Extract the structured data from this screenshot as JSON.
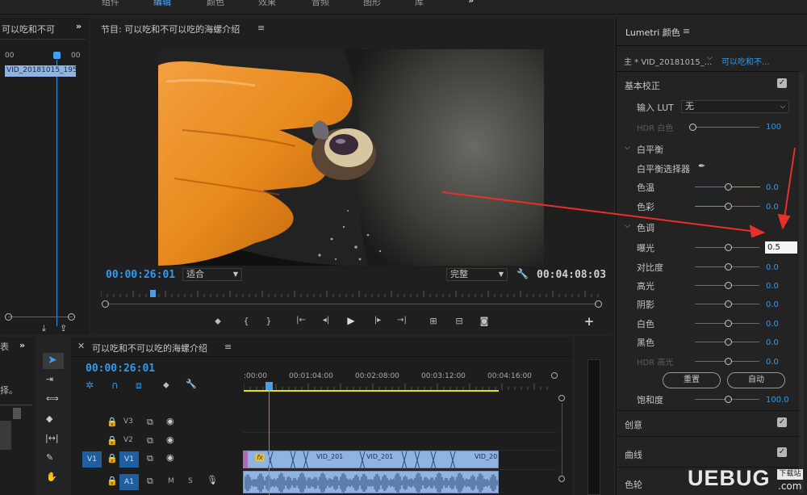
{
  "workspaces": [
    "组件",
    "编辑",
    "颜色",
    "效果",
    "音频",
    "图形",
    "库"
  ],
  "workspace_active": "编辑",
  "source": {
    "title": "可以吃和不可",
    "ruler_left": "00",
    "ruler_right": "00",
    "clip": "VID_20181015_195"
  },
  "program": {
    "title": "节目: 可以吃和不可以吃的海螺介绍",
    "timecode": "00:00:26:01",
    "fit": "适合",
    "quality": "完整",
    "duration": "00:04:08:03",
    "controls": [
      "marker",
      "in",
      "out",
      "go-in",
      "step-back",
      "play",
      "step-forward",
      "go-out",
      "lift",
      "extract",
      "export-frame",
      "add"
    ],
    "control_glyphs": [
      "⬥",
      "{",
      "}",
      "|←",
      "◂|",
      "▶",
      "|▸",
      "→|",
      "⊞",
      "⊟",
      "◙",
      "+"
    ]
  },
  "timeline": {
    "title": "可以吃和不可以吃的海螺介绍",
    "timecode": "00:00:26:01",
    "ruler": [
      ":00:00",
      "00:01:04:00",
      "00:02:08:00",
      "00:03:12:00",
      "00:04:16:00"
    ],
    "tracks": [
      {
        "name": "V3",
        "src": ""
      },
      {
        "name": "V2",
        "src": ""
      },
      {
        "name": "V1",
        "src": "V1"
      },
      {
        "name": "A1",
        "src": ""
      }
    ],
    "track_buttons": [
      "M",
      "S"
    ],
    "clip_labels": [
      "VID_201",
      "VID_201",
      "VID_20"
    ],
    "fx_badge": "fx"
  },
  "left_truncated": {
    "label1": "表",
    "label2": "择。"
  },
  "lumetri": {
    "title": "Lumetri 颜色",
    "master_clip": "主 * VID_20181015_...",
    "sequence_clip": "可以吃和不...",
    "basic_correction": "基本校正",
    "input_lut_label": "输入 LUT",
    "input_lut_value": "无",
    "hdr_white_label": "HDR 白色",
    "hdr_white_value": "100",
    "white_balance": "白平衡",
    "wb_selector": "白平衡选择器",
    "temperature_label": "色温",
    "temperature_value": "0.0",
    "tint_label": "色彩",
    "tint_value": "0.0",
    "tone": "色调",
    "exposure_label": "曝光",
    "exposure_value": "0.5",
    "contrast_label": "对比度",
    "contrast_value": "0.0",
    "highlights_label": "高光",
    "highlights_value": "0.0",
    "shadows_label": "阴影",
    "shadows_value": "0.0",
    "whites_label": "白色",
    "whites_value": "0.0",
    "blacks_label": "黑色",
    "blacks_value": "0.0",
    "hdr_spec_label": "HDR 高光",
    "hdr_spec_value": "0.0",
    "reset_button": "重置",
    "auto_button": "自动",
    "saturation_label": "饱和度",
    "saturation_value": "100.0",
    "creative": "创意",
    "curves": "曲线",
    "color_wheels": "色轮"
  },
  "watermark": {
    "logo": "UEBUG",
    "badge": "下载站",
    "domain": ".com"
  },
  "colors": {
    "accent_blue": "#2f9bf0",
    "clip_blue": "#8fb4e3",
    "annotation_red": "#e8302a",
    "work_area_yellow": "#e6e01a"
  }
}
